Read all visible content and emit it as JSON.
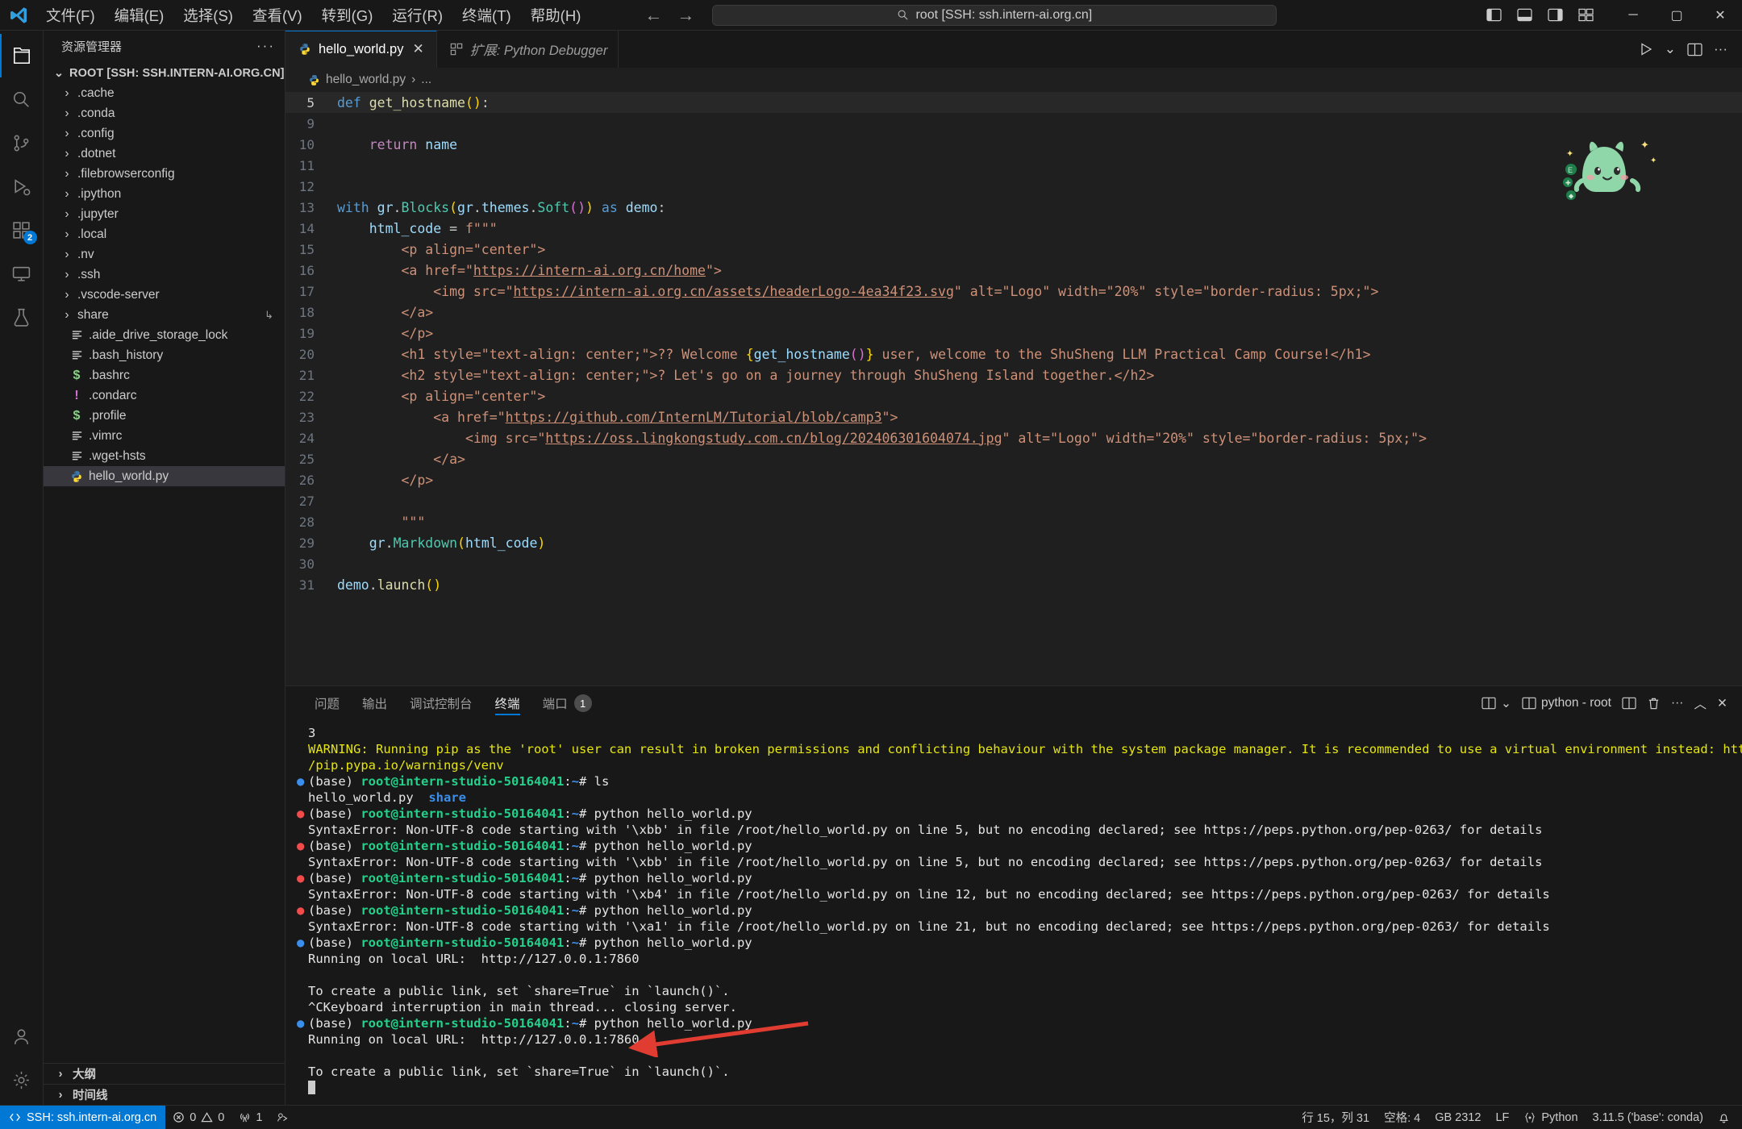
{
  "titlebar": {
    "menu": [
      "文件(F)",
      "编辑(E)",
      "选择(S)",
      "查看(V)",
      "转到(G)",
      "运行(R)",
      "终端(T)",
      "帮助(H)"
    ],
    "back_icon": "←",
    "forward_icon": "→",
    "quickinput_text": "root [SSH: ssh.intern-ai.org.cn]",
    "window_minimize": "─",
    "window_maximize": "▢",
    "window_close": "✕"
  },
  "activitybar": {
    "items": [
      {
        "name": "explorer",
        "badge": ""
      },
      {
        "name": "search",
        "badge": ""
      },
      {
        "name": "source-control",
        "badge": ""
      },
      {
        "name": "run-and-debug",
        "badge": ""
      },
      {
        "name": "extensions",
        "badge": "2"
      },
      {
        "name": "remote-explorer",
        "badge": ""
      },
      {
        "name": "testing",
        "badge": ""
      }
    ],
    "bottom": [
      {
        "name": "accounts"
      },
      {
        "name": "settings"
      }
    ]
  },
  "sidebar": {
    "title": "资源管理器",
    "more_label": "···",
    "root_label": "ROOT [SSH: SSH.INTERN-AI.ORG.CN]",
    "items": [
      {
        "label": ".cache",
        "type": "folder"
      },
      {
        "label": ".conda",
        "type": "folder"
      },
      {
        "label": ".config",
        "type": "folder"
      },
      {
        "label": ".dotnet",
        "type": "folder"
      },
      {
        "label": ".filebrowserconfig",
        "type": "folder"
      },
      {
        "label": ".ipython",
        "type": "folder"
      },
      {
        "label": ".jupyter",
        "type": "folder"
      },
      {
        "label": ".local",
        "type": "folder"
      },
      {
        "label": ".nv",
        "type": "folder"
      },
      {
        "label": ".ssh",
        "type": "folder"
      },
      {
        "label": ".vscode-server",
        "type": "folder"
      },
      {
        "label": "share",
        "type": "folder",
        "tail": "↳"
      },
      {
        "label": ".aide_drive_storage_lock",
        "type": "file-lines"
      },
      {
        "label": ".bash_history",
        "type": "file-lines"
      },
      {
        "label": ".bashrc",
        "type": "file-shell"
      },
      {
        "label": ".condarc",
        "type": "file-config"
      },
      {
        "label": ".profile",
        "type": "file-shell"
      },
      {
        "label": ".vimrc",
        "type": "file-lines"
      },
      {
        "label": ".wget-hsts",
        "type": "file-lines"
      },
      {
        "label": "hello_world.py",
        "type": "file-python",
        "selected": true
      }
    ],
    "sections": [
      "大纲",
      "时间线"
    ]
  },
  "editor": {
    "tabs": [
      {
        "label": "hello_world.py",
        "icon": "python-icon",
        "active": true,
        "closable": true
      },
      {
        "label": "扩展: Python Debugger",
        "icon": "extensions-icon",
        "active": false,
        "italic": true
      }
    ],
    "actions": [
      "run-button",
      "run-dropdown",
      "split-editor-button",
      "more-actions-button"
    ],
    "breadcrumb": [
      "hello_world.py",
      "..."
    ],
    "lines": [
      {
        "num": "5",
        "current": true,
        "indent": 0,
        "tokens": [
          {
            "t": "def ",
            "c": "kw"
          },
          {
            "t": "get_hostname",
            "c": "fn"
          },
          {
            "t": "(",
            "c": "par1"
          },
          {
            "t": ")",
            "c": "par1"
          },
          {
            "t": ":",
            "c": "plain"
          }
        ]
      },
      {
        "num": "9",
        "current": false,
        "indent": 1,
        "tokens": []
      },
      {
        "num": "10",
        "current": false,
        "indent": 1,
        "tokens": [
          {
            "t": "    ",
            "c": "plain"
          },
          {
            "t": "return ",
            "c": "kw2"
          },
          {
            "t": "name",
            "c": "var"
          }
        ]
      },
      {
        "num": "11",
        "current": false,
        "indent": 0,
        "tokens": []
      },
      {
        "num": "12",
        "current": false,
        "indent": 0,
        "tokens": []
      },
      {
        "num": "13",
        "current": false,
        "indent": 0,
        "tokens": [
          {
            "t": "with ",
            "c": "kw"
          },
          {
            "t": "gr",
            "c": "var"
          },
          {
            "t": ".",
            "c": "plain"
          },
          {
            "t": "Blocks",
            "c": "cls"
          },
          {
            "t": "(",
            "c": "par1"
          },
          {
            "t": "gr",
            "c": "var"
          },
          {
            "t": ".",
            "c": "plain"
          },
          {
            "t": "themes",
            "c": "var"
          },
          {
            "t": ".",
            "c": "plain"
          },
          {
            "t": "Soft",
            "c": "cls"
          },
          {
            "t": "(",
            "c": "par2"
          },
          {
            "t": ")",
            "c": "par2"
          },
          {
            "t": ")",
            "c": "par1"
          },
          {
            "t": " ",
            "c": "plain"
          },
          {
            "t": "as ",
            "c": "kw"
          },
          {
            "t": "demo",
            "c": "var"
          },
          {
            "t": ":",
            "c": "plain"
          }
        ]
      },
      {
        "num": "14",
        "current": false,
        "indent": 1,
        "tokens": [
          {
            "t": "    ",
            "c": "plain"
          },
          {
            "t": "html_code",
            "c": "var"
          },
          {
            "t": " = ",
            "c": "plain"
          },
          {
            "t": "f\"\"\"",
            "c": "str"
          }
        ]
      },
      {
        "num": "15",
        "current": false,
        "indent": 2,
        "tokens": [
          {
            "t": "        <p align=\"center\">",
            "c": "str"
          }
        ]
      },
      {
        "num": "16",
        "current": false,
        "indent": 2,
        "tokens": [
          {
            "t": "        <a href=\"",
            "c": "str"
          },
          {
            "t": "https://intern-ai.org.cn/home",
            "c": "link"
          },
          {
            "t": "\">",
            "c": "str"
          }
        ]
      },
      {
        "num": "17",
        "current": false,
        "indent": 3,
        "tokens": [
          {
            "t": "            <img src=\"",
            "c": "str"
          },
          {
            "t": "https://intern-ai.org.cn/assets/headerLogo-4ea34f23.svg",
            "c": "link"
          },
          {
            "t": "\" alt=\"Logo\" width=\"20%\" style=\"border-radius: 5px;\">",
            "c": "str"
          }
        ]
      },
      {
        "num": "18",
        "current": false,
        "indent": 2,
        "tokens": [
          {
            "t": "        </a>",
            "c": "str"
          }
        ]
      },
      {
        "num": "19",
        "current": false,
        "indent": 2,
        "tokens": [
          {
            "t": "        </p>",
            "c": "str"
          }
        ]
      },
      {
        "num": "20",
        "current": false,
        "indent": 2,
        "tokens": [
          {
            "t": "        <h1 style=\"text-align: center;\">?? Welcome ",
            "c": "str"
          },
          {
            "t": "{",
            "c": "par1"
          },
          {
            "t": "get_hostname",
            "c": "var"
          },
          {
            "t": "(",
            "c": "par2"
          },
          {
            "t": ")",
            "c": "par2"
          },
          {
            "t": "}",
            "c": "par1"
          },
          {
            "t": " user, welcome to the ShuSheng LLM Practical Camp Course!</h1>",
            "c": "str"
          }
        ]
      },
      {
        "num": "21",
        "current": false,
        "indent": 2,
        "tokens": [
          {
            "t": "        <h2 style=\"text-align: center;\">? Let's go on a journey through ShuSheng Island together.</h2>",
            "c": "str"
          }
        ]
      },
      {
        "num": "22",
        "current": false,
        "indent": 2,
        "tokens": [
          {
            "t": "        <p align=\"center\">",
            "c": "str"
          }
        ]
      },
      {
        "num": "23",
        "current": false,
        "indent": 3,
        "tokens": [
          {
            "t": "            <a href=\"",
            "c": "str"
          },
          {
            "t": "https://github.com/InternLM/Tutorial/blob/camp3",
            "c": "link"
          },
          {
            "t": "\">",
            "c": "str"
          }
        ]
      },
      {
        "num": "24",
        "current": false,
        "indent": 4,
        "tokens": [
          {
            "t": "                <img src=\"",
            "c": "str"
          },
          {
            "t": "https://oss.lingkongstudy.com.cn/blog/202406301604074.jpg",
            "c": "link"
          },
          {
            "t": "\" alt=\"Logo\" width=\"20%\" style=\"border-radius: 5px;\">",
            "c": "str"
          }
        ]
      },
      {
        "num": "25",
        "current": false,
        "indent": 3,
        "tokens": [
          {
            "t": "            </a>",
            "c": "str"
          }
        ]
      },
      {
        "num": "26",
        "current": false,
        "indent": 2,
        "tokens": [
          {
            "t": "        </p>",
            "c": "str"
          }
        ]
      },
      {
        "num": "27",
        "current": false,
        "indent": 2,
        "tokens": []
      },
      {
        "num": "28",
        "current": false,
        "indent": 2,
        "tokens": [
          {
            "t": "        \"\"\"",
            "c": "str"
          }
        ]
      },
      {
        "num": "29",
        "current": false,
        "indent": 1,
        "tokens": [
          {
            "t": "    ",
            "c": "plain"
          },
          {
            "t": "gr",
            "c": "var"
          },
          {
            "t": ".",
            "c": "plain"
          },
          {
            "t": "Markdown",
            "c": "cls"
          },
          {
            "t": "(",
            "c": "par1"
          },
          {
            "t": "html_code",
            "c": "var"
          },
          {
            "t": ")",
            "c": "par1"
          }
        ]
      },
      {
        "num": "30",
        "current": false,
        "indent": 0,
        "tokens": []
      },
      {
        "num": "31",
        "current": false,
        "indent": 0,
        "tokens": [
          {
            "t": "demo",
            "c": "var"
          },
          {
            "t": ".",
            "c": "plain"
          },
          {
            "t": "launch",
            "c": "fn"
          },
          {
            "t": "(",
            "c": "par1"
          },
          {
            "t": ")",
            "c": "par1"
          }
        ]
      }
    ]
  },
  "panel": {
    "tabs": [
      {
        "label": "问题",
        "active": false,
        "badge": ""
      },
      {
        "label": "输出",
        "active": false,
        "badge": ""
      },
      {
        "label": "调试控制台",
        "active": false,
        "badge": ""
      },
      {
        "label": "终端",
        "active": true,
        "badge": ""
      },
      {
        "label": "端口",
        "active": false,
        "badge": "1"
      }
    ],
    "terminal_name": "python - root",
    "actions": [
      "split-panel-dropdown",
      "new-terminal-button",
      "split-terminal-button",
      "kill-terminal-button",
      "more-actions-button",
      "maximize-panel-button",
      "close-panel-button"
    ],
    "terminal_lines": [
      {
        "dot": "",
        "segments": [
          {
            "t": "3",
            "c": "white"
          }
        ]
      },
      {
        "dot": "",
        "segments": [
          {
            "t": "WARNING: Running pip as the 'root' user can result in broken permissions and conflicting behaviour with the system package manager. It is recommended to use a virtual environment instead: https:/",
            "c": "warn"
          }
        ]
      },
      {
        "dot": "",
        "segments": [
          {
            "t": "/pip.pypa.io/warnings/venv",
            "c": "warn"
          }
        ]
      },
      {
        "dot": "blue",
        "segments": [
          {
            "t": "(base) ",
            "c": "white"
          },
          {
            "t": "root@intern-studio-50164041",
            "c": "green"
          },
          {
            "t": ":",
            "c": "white"
          },
          {
            "t": "~",
            "c": "blue"
          },
          {
            "t": "# ls",
            "c": "white"
          }
        ]
      },
      {
        "dot": "",
        "segments": [
          {
            "t": "hello_world.py  ",
            "c": "white"
          },
          {
            "t": "share",
            "c": "blue"
          }
        ]
      },
      {
        "dot": "red",
        "segments": [
          {
            "t": "(base) ",
            "c": "white"
          },
          {
            "t": "root@intern-studio-50164041",
            "c": "green"
          },
          {
            "t": ":",
            "c": "white"
          },
          {
            "t": "~",
            "c": "blue"
          },
          {
            "t": "# python hello_world.py",
            "c": "white"
          }
        ]
      },
      {
        "dot": "",
        "segments": [
          {
            "t": "SyntaxError: Non-UTF-8 code starting with '\\xbb' in file /root/hello_world.py on line 5, but no encoding declared; see https://peps.python.org/pep-0263/ for details",
            "c": "white"
          }
        ]
      },
      {
        "dot": "red",
        "segments": [
          {
            "t": "(base) ",
            "c": "white"
          },
          {
            "t": "root@intern-studio-50164041",
            "c": "green"
          },
          {
            "t": ":",
            "c": "white"
          },
          {
            "t": "~",
            "c": "blue"
          },
          {
            "t": "# python hello_world.py",
            "c": "white"
          }
        ]
      },
      {
        "dot": "",
        "segments": [
          {
            "t": "SyntaxError: Non-UTF-8 code starting with '\\xbb' in file /root/hello_world.py on line 5, but no encoding declared; see https://peps.python.org/pep-0263/ for details",
            "c": "white"
          }
        ]
      },
      {
        "dot": "red",
        "segments": [
          {
            "t": "(base) ",
            "c": "white"
          },
          {
            "t": "root@intern-studio-50164041",
            "c": "green"
          },
          {
            "t": ":",
            "c": "white"
          },
          {
            "t": "~",
            "c": "blue"
          },
          {
            "t": "# python hello_world.py",
            "c": "white"
          }
        ]
      },
      {
        "dot": "",
        "segments": [
          {
            "t": "SyntaxError: Non-UTF-8 code starting with '\\xb4' in file /root/hello_world.py on line 12, but no encoding declared; see https://peps.python.org/pep-0263/ for details",
            "c": "white"
          }
        ]
      },
      {
        "dot": "red",
        "segments": [
          {
            "t": "(base) ",
            "c": "white"
          },
          {
            "t": "root@intern-studio-50164041",
            "c": "green"
          },
          {
            "t": ":",
            "c": "white"
          },
          {
            "t": "~",
            "c": "blue"
          },
          {
            "t": "# python hello_world.py",
            "c": "white"
          }
        ]
      },
      {
        "dot": "",
        "segments": [
          {
            "t": "SyntaxError: Non-UTF-8 code starting with '\\xa1' in file /root/hello_world.py on line 21, but no encoding declared; see https://peps.python.org/pep-0263/ for details",
            "c": "white"
          }
        ]
      },
      {
        "dot": "blue",
        "segments": [
          {
            "t": "(base) ",
            "c": "white"
          },
          {
            "t": "root@intern-studio-50164041",
            "c": "green"
          },
          {
            "t": ":",
            "c": "white"
          },
          {
            "t": "~",
            "c": "blue"
          },
          {
            "t": "# python hello_world.py",
            "c": "white"
          }
        ]
      },
      {
        "dot": "",
        "segments": [
          {
            "t": "Running on local URL:  http://127.0.0.1:7860",
            "c": "white"
          }
        ]
      },
      {
        "dot": "",
        "segments": [
          {
            "t": "",
            "c": "white"
          }
        ]
      },
      {
        "dot": "",
        "segments": [
          {
            "t": "To create a public link, set `share=True` in `launch()`.",
            "c": "white"
          }
        ]
      },
      {
        "dot": "",
        "segments": [
          {
            "t": "^CKeyboard interruption in main thread... closing server.",
            "c": "white"
          }
        ]
      },
      {
        "dot": "blue",
        "segments": [
          {
            "t": "(base) ",
            "c": "white"
          },
          {
            "t": "root@intern-studio-50164041",
            "c": "green"
          },
          {
            "t": ":",
            "c": "white"
          },
          {
            "t": "~",
            "c": "blue"
          },
          {
            "t": "# python hello_world.py",
            "c": "white"
          }
        ]
      },
      {
        "dot": "",
        "segments": [
          {
            "t": "Running on local URL:  http://127.0.0.1:7860",
            "c": "white"
          }
        ]
      },
      {
        "dot": "",
        "segments": [
          {
            "t": "",
            "c": "white"
          }
        ]
      },
      {
        "dot": "",
        "segments": [
          {
            "t": "To create a public link, set `share=True` in `launch()`.",
            "c": "white"
          }
        ]
      }
    ],
    "annotation_arrow_color": "#e03c31"
  },
  "statusbar": {
    "remote_label": "SSH: ssh.intern-ai.org.cn",
    "errors": "0",
    "warnings": "0",
    "radio_tower_count": "1",
    "items_right": [
      {
        "label": "行 15，列 31",
        "name": "cursor-position"
      },
      {
        "label": "空格: 4",
        "name": "indentation"
      },
      {
        "label": "GB 2312",
        "name": "encoding"
      },
      {
        "label": "LF",
        "name": "eol"
      },
      {
        "label": "Python",
        "name": "language-mode"
      },
      {
        "label": "3.11.5 ('base': conda)",
        "name": "python-interpreter"
      }
    ]
  },
  "colors": {
    "accent": "#0078d4",
    "bg": "#1f1f1f",
    "panel_bg": "#181818",
    "string": "#ce9178",
    "keyword": "#569cd6",
    "warn": "#e5e510"
  }
}
